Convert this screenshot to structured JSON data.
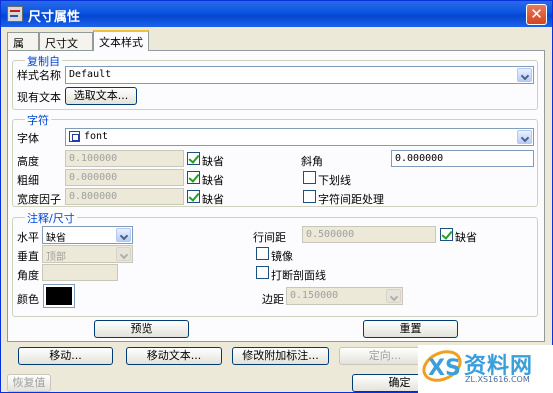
{
  "window": {
    "title": "尺寸属性",
    "close_symbol": "✕"
  },
  "tabs": [
    {
      "label": "属性",
      "active": false
    },
    {
      "label": "尺寸文本",
      "active": false
    },
    {
      "label": "文本样式",
      "active": true
    }
  ],
  "copy_from": {
    "legend": "复制自",
    "style_name_label": "样式名称",
    "style_name_value": "Default",
    "existing_text_label": "现有文本",
    "select_text_button": "选取文本..."
  },
  "character": {
    "legend": "字符",
    "font_label": "字体",
    "font_value": "font",
    "height_label": "高度",
    "height_value": "0.100000",
    "height_default_label": "缺省",
    "height_default_checked": true,
    "thickness_label": "粗细",
    "thickness_value": "0.000000",
    "thickness_default_label": "缺省",
    "thickness_default_checked": true,
    "width_factor_label": "宽度因子",
    "width_factor_value": "0.800000",
    "width_factor_default_label": "缺省",
    "width_factor_default_checked": true,
    "slant_label": "斜角",
    "slant_value": "0.000000",
    "underline_label": "下划线",
    "underline_checked": false,
    "kerning_label": "字符间距处理",
    "kerning_checked": false
  },
  "note_dimension": {
    "legend": "注释/尺寸",
    "horizontal_label": "水平",
    "horizontal_value": "缺省",
    "vertical_label": "垂直",
    "vertical_value": "顶部",
    "angle_label": "角度",
    "angle_value": "",
    "color_label": "颜色",
    "color_value": "#000000",
    "line_spacing_label": "行间距",
    "line_spacing_value": "0.500000",
    "line_spacing_default_label": "缺省",
    "line_spacing_default_checked": true,
    "mirror_label": "镜像",
    "mirror_checked": false,
    "break_hatch_label": "打断剖面线",
    "break_hatch_checked": false,
    "margin_label": "边距",
    "margin_value": "0.150000"
  },
  "panel_buttons": {
    "preview": "预览",
    "reset": "重置"
  },
  "bottom_row": {
    "move": "移动...",
    "move_text": "移动文本...",
    "edit_attachment": "修改附加标注...",
    "orient": "定向..."
  },
  "footer": {
    "restore": "恢复值",
    "ok": "确定"
  },
  "watermark": {
    "text": "资料网",
    "url": "ZL.XS1616.COM"
  }
}
